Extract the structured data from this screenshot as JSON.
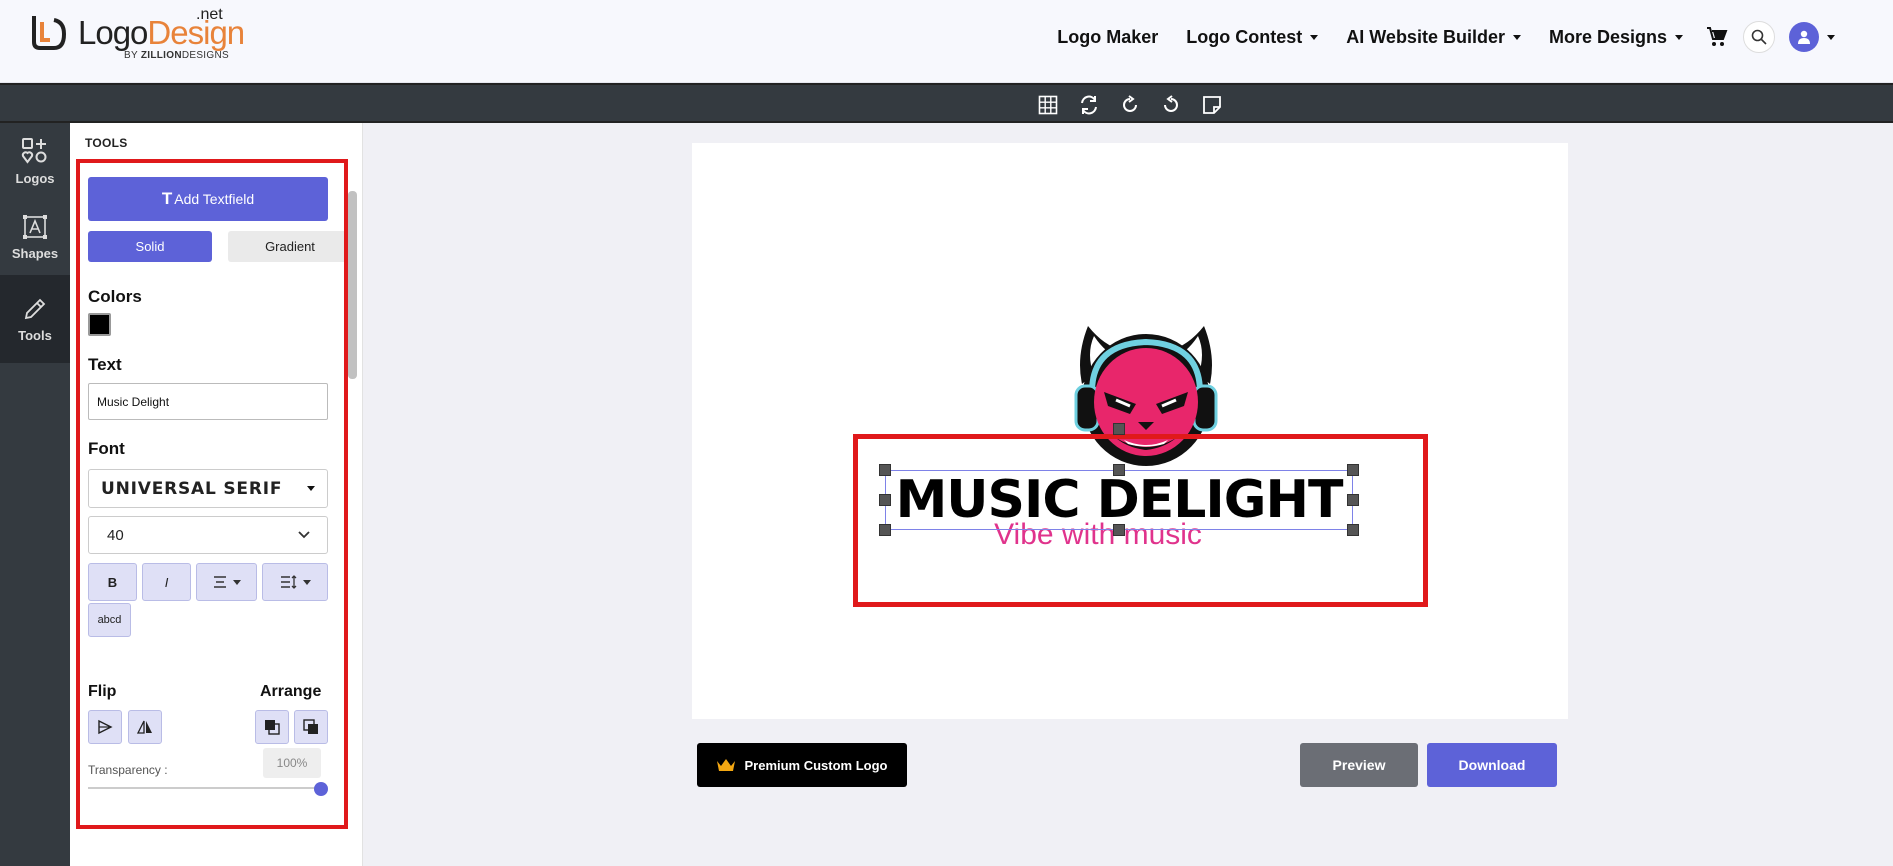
{
  "brand": {
    "word1": "Logo",
    "word2": "Design",
    "suffix": ".net",
    "by": "BY",
    "by_company_bold": "ZILLION",
    "by_company": "DESIGNS"
  },
  "nav": {
    "logo_maker": "Logo Maker",
    "logo_contest": "Logo Contest",
    "ai_website_builder": "AI Website Builder",
    "more_designs": "More Designs"
  },
  "toolbar_icons": [
    "grid-icon",
    "swap-icon",
    "rotate-right-icon",
    "rotate-left-icon",
    "sticky-note-icon"
  ],
  "rail": {
    "logos": "Logos",
    "shapes": "Shapes",
    "tools": "Tools"
  },
  "panel": {
    "title": "TOOLS",
    "add_textfield": "Add Textfield",
    "add_textfield_glyph": "T",
    "solid": "Solid",
    "gradient": "Gradient",
    "colors_label": "Colors",
    "color_value": "#000000",
    "text_label": "Text",
    "text_value": "Music Delight",
    "font_label": "Font",
    "font_value": "UNIVERSAL SERIF",
    "size_value": "40",
    "bold": "B",
    "italic": "I",
    "case": "abcd",
    "flip_label": "Flip",
    "arrange_label": "Arrange",
    "transparency_label": "Transparency :",
    "transparency_value": "100%"
  },
  "canvas": {
    "brand_name": "MUSIC DELIGHT",
    "slogan": "Vibe with music",
    "slogan_color": "#e0338c"
  },
  "actions": {
    "premium": "Premium Custom Logo",
    "preview": "Preview",
    "download": "Download"
  },
  "colors": {
    "accent": "#5d62d8",
    "highlight": "#e0191b",
    "dark": "#343a40"
  }
}
